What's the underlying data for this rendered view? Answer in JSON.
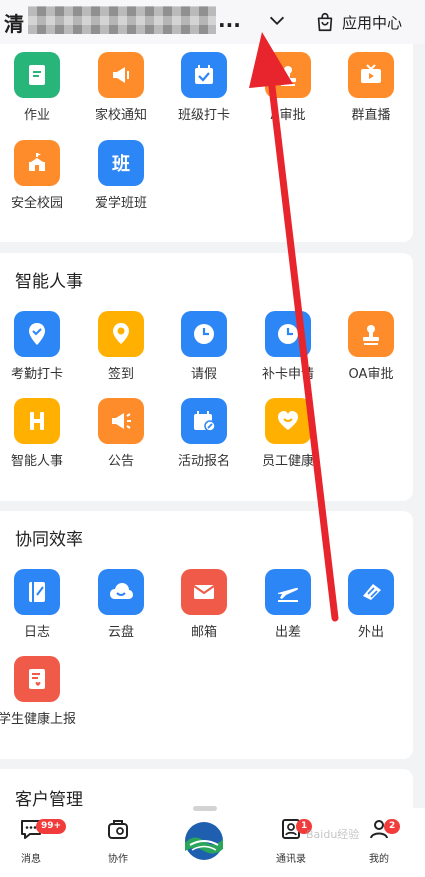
{
  "header": {
    "title_first_char": "清",
    "title_ellipsis": "...",
    "app_center_label": "应用中心"
  },
  "sections": {
    "top": {
      "items": [
        {
          "label": "作业",
          "icon": "homework-icon",
          "color": "#27b57a"
        },
        {
          "label": "家校通知",
          "icon": "megaphone-icon",
          "color": "#ff8c2b"
        },
        {
          "label": "班级打卡",
          "icon": "calendar-check-icon",
          "color": "#2d86f5"
        },
        {
          "label": "A审批",
          "icon": "stamp-icon",
          "color": "#ff8c2b"
        },
        {
          "label": "群直播",
          "icon": "tv-icon",
          "color": "#ff8c2b"
        },
        {
          "label": "安全校园",
          "icon": "school-icon",
          "color": "#ff8c2b"
        },
        {
          "label": "爱学班班",
          "icon": "ban-icon",
          "color": "#2d86f5"
        }
      ]
    },
    "hr": {
      "title": "智能人事",
      "items": [
        {
          "label": "考勤打卡",
          "icon": "location-check-icon",
          "color": "#2d86f5"
        },
        {
          "label": "签到",
          "icon": "pin-icon",
          "color": "#ffb000"
        },
        {
          "label": "请假",
          "icon": "clock-icon",
          "color": "#2d86f5"
        },
        {
          "label": "补卡申请",
          "icon": "clock-icon",
          "color": "#2d86f5"
        },
        {
          "label": "OA审批",
          "icon": "stamp-icon",
          "color": "#ff8c2b"
        },
        {
          "label": "智能人事",
          "icon": "h-icon",
          "color": "#ffb000"
        },
        {
          "label": "公告",
          "icon": "megaphone-icon",
          "color": "#ff8c2b"
        },
        {
          "label": "活动报名",
          "icon": "calendar-edit-icon",
          "color": "#2d86f5"
        },
        {
          "label": "员工健康",
          "icon": "heart-icon",
          "color": "#ffb000"
        }
      ]
    },
    "collab": {
      "title": "协同效率",
      "items": [
        {
          "label": "日志",
          "icon": "notebook-icon",
          "color": "#2d86f5"
        },
        {
          "label": "云盘",
          "icon": "cloud-icon",
          "color": "#2d86f5"
        },
        {
          "label": "邮箱",
          "icon": "mail-icon",
          "color": "#f05a48"
        },
        {
          "label": "出差",
          "icon": "plane-icon",
          "color": "#2d86f5"
        },
        {
          "label": "外出",
          "icon": "flag-icon",
          "color": "#2d86f5"
        },
        {
          "label": "学生健康上报",
          "icon": "report-icon",
          "color": "#f05a48"
        }
      ]
    },
    "crm": {
      "title": "客户管理"
    }
  },
  "tabbar": {
    "items": [
      {
        "label": "消息",
        "icon": "message-icon",
        "badge": "99+"
      },
      {
        "label": "协作",
        "icon": "collab-icon",
        "badge": ""
      },
      {
        "label": "",
        "icon": "app-logo",
        "badge": ""
      },
      {
        "label": "通讯录",
        "icon": "contacts-icon",
        "badge": "1"
      },
      {
        "label": "我的",
        "icon": "profile-icon",
        "badge": "2"
      }
    ]
  },
  "watermark": "Baidu经验",
  "colors": {
    "accent_blue": "#2d86f5",
    "accent_orange": "#ff8c2b",
    "badge_red": "#f23c3c",
    "annotation_arrow": "#e8242c"
  }
}
